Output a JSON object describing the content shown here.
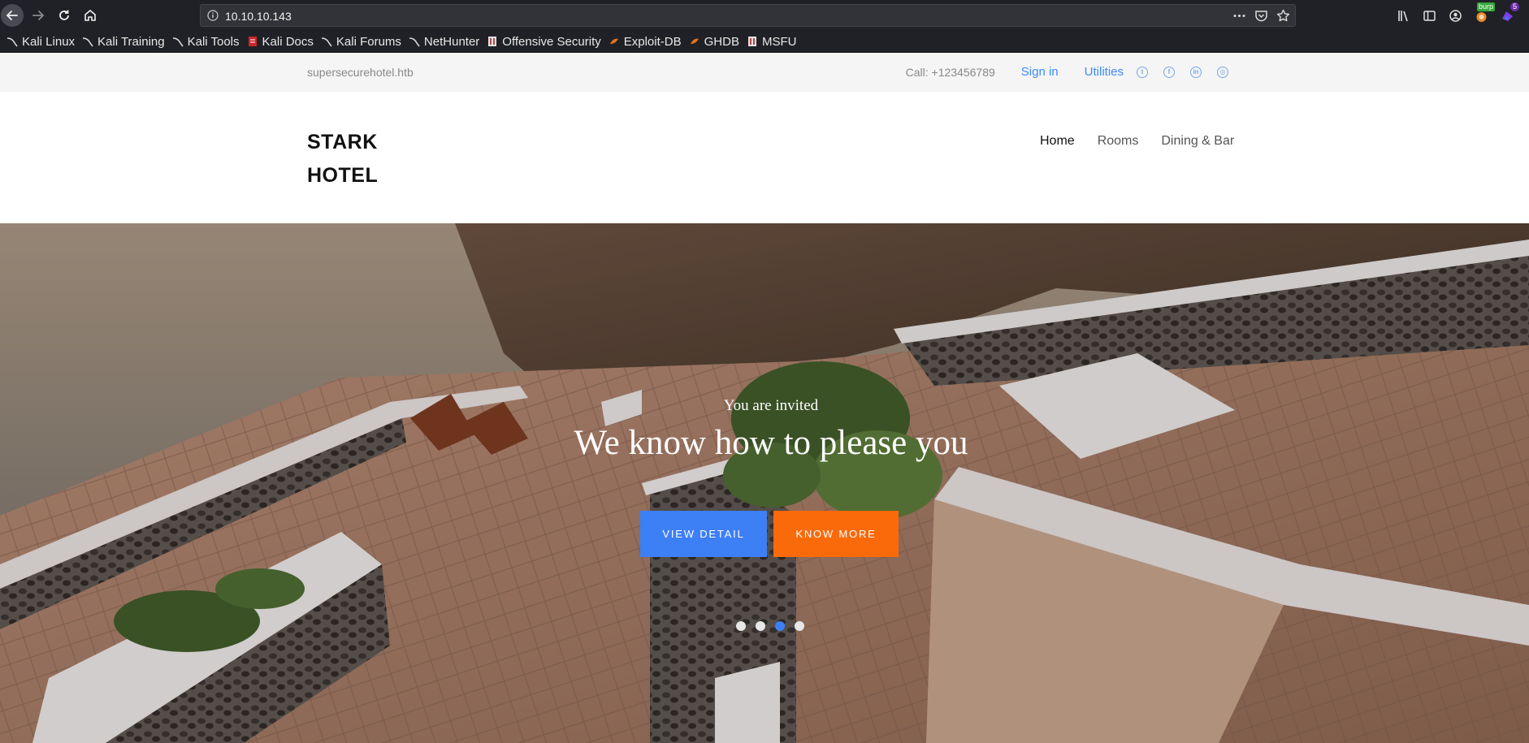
{
  "browser": {
    "url": "10.10.10.143",
    "extensions": {
      "burp_label": "burp",
      "notification_count": "5"
    },
    "bookmarks": [
      {
        "label": "Kali Linux",
        "icon": "kali-dragon-icon"
      },
      {
        "label": "Kali Training",
        "icon": "kali-dragon-icon"
      },
      {
        "label": "Kali Tools",
        "icon": "kali-dragon-icon"
      },
      {
        "label": "Kali Docs",
        "icon": "kali-docs-icon"
      },
      {
        "label": "Kali Forums",
        "icon": "kali-dragon-icon"
      },
      {
        "label": "NetHunter",
        "icon": "kali-dragon-icon"
      },
      {
        "label": "Offensive Security",
        "icon": "offsec-icon"
      },
      {
        "label": "Exploit-DB",
        "icon": "exploitdb-icon"
      },
      {
        "label": "GHDB",
        "icon": "exploitdb-icon"
      },
      {
        "label": "MSFU",
        "icon": "offsec-icon"
      }
    ]
  },
  "site": {
    "topbar": {
      "domain": "supersecurehotel.htb",
      "call": "Call: +123456789",
      "signin": "Sign in",
      "utilities": "Utilities",
      "social_icons": [
        "twitter-icon",
        "facebook-icon",
        "linkedin-icon",
        "dribbble-icon"
      ]
    },
    "brand": {
      "line1": "STARK",
      "line2": "HOTEL"
    },
    "nav": {
      "home": "Home",
      "rooms": "Rooms",
      "dining": "Dining & Bar"
    },
    "hero": {
      "subtitle": "You are invited",
      "title": "We know how to please you",
      "btn_detail": "VIEW DETAIL",
      "btn_more": "KNOW MORE",
      "slide_count": 4,
      "active_slide": 3
    }
  },
  "colors": {
    "accent_blue": "#3d7ff5",
    "accent_orange": "#fa6a0b",
    "link_blue": "#3d8bfd",
    "browser_dark": "#202126"
  }
}
